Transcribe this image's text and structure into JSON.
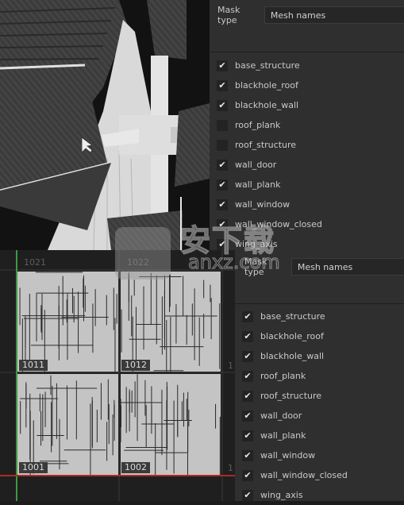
{
  "top_panel": {
    "mask_type_label": "Mask type",
    "mask_type_value": "Mesh names",
    "items": [
      {
        "label": "base_structure",
        "checked": true
      },
      {
        "label": "blackhole_roof",
        "checked": true
      },
      {
        "label": "blackhole_wall",
        "checked": true
      },
      {
        "label": "roof_plank",
        "checked": false
      },
      {
        "label": "roof_structure",
        "checked": false
      },
      {
        "label": "wall_door",
        "checked": true
      },
      {
        "label": "wall_plank",
        "checked": true
      },
      {
        "label": "wall_window",
        "checked": true
      },
      {
        "label": "wall_window_closed",
        "checked": true
      },
      {
        "label": "wing_axis",
        "checked": true
      }
    ]
  },
  "bottom_panel": {
    "mask_type_label": "Mask type",
    "mask_type_value": "Mesh names",
    "items": [
      {
        "label": "base_structure",
        "checked": true
      },
      {
        "label": "blackhole_roof",
        "checked": true
      },
      {
        "label": "blackhole_wall",
        "checked": true
      },
      {
        "label": "roof_plank",
        "checked": true
      },
      {
        "label": "roof_structure",
        "checked": true
      },
      {
        "label": "wall_door",
        "checked": true
      },
      {
        "label": "wall_plank",
        "checked": true
      },
      {
        "label": "wall_window",
        "checked": true
      },
      {
        "label": "wall_window_closed",
        "checked": true
      },
      {
        "label": "wing_axis",
        "checked": true
      }
    ]
  },
  "uv_view": {
    "tiles": {
      "t1021": "1021",
      "t1022": "1022",
      "t1011": "1011",
      "t1012": "1012",
      "t1001": "1001",
      "t1002": "1002",
      "edge_top": "1",
      "edge_bottom": "1"
    }
  },
  "icons": {
    "check": "✔"
  },
  "watermark": {
    "text": "安下载",
    "sub": "anxz.com"
  },
  "colors": {
    "panel_bg": "#2f2f2f",
    "uv_island": "#c4c4c4",
    "v_axis": "#3c9a3c",
    "u_axis": "#b02828"
  }
}
